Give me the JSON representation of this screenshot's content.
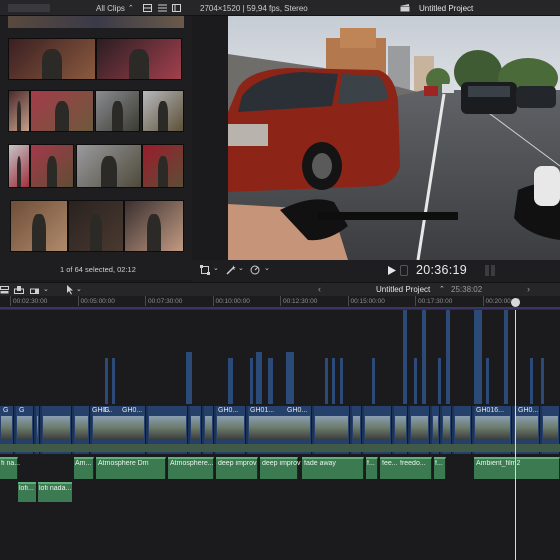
{
  "topbar": {
    "filter_label": "All Clips",
    "format_info": "2704×1520 | 59,94 fps, Stereo",
    "project_title": "Untitled Project"
  },
  "browser": {
    "selection_status": "1 of 64 selected, 02:12"
  },
  "viewer": {
    "timecode": "20:36:19"
  },
  "timeline": {
    "project_name": "Untitled Project",
    "duration": "25:38:02",
    "ruler_ticks": [
      "00:02:30:00",
      "00:05:00:00",
      "00:07:30:00",
      "00:10:00:00",
      "00:12:30:00",
      "00:15:00:00",
      "00:17:30:00",
      "00:20:00:00"
    ],
    "video_clip_labels": [
      "G",
      "G",
      "GH0...",
      "G",
      "GH0...",
      "GH0...",
      "GH01...",
      "GH0...",
      "GH016...",
      "GH0..."
    ],
    "audio_clips": [
      {
        "label": "fi na..."
      },
      {
        "label": "Am..."
      },
      {
        "label": "Atmosphere Dm"
      },
      {
        "label": "Atmosphere..."
      },
      {
        "label": "deep improv"
      },
      {
        "label": "deep improv"
      },
      {
        "label": "fade away"
      },
      {
        "label": "f..."
      },
      {
        "label": "fee..."
      },
      {
        "label": "freedo..."
      },
      {
        "label": "f..."
      },
      {
        "label": "Ambient_film2"
      },
      {
        "label": "lofi..."
      },
      {
        "label": "lofi nada..."
      }
    ]
  }
}
